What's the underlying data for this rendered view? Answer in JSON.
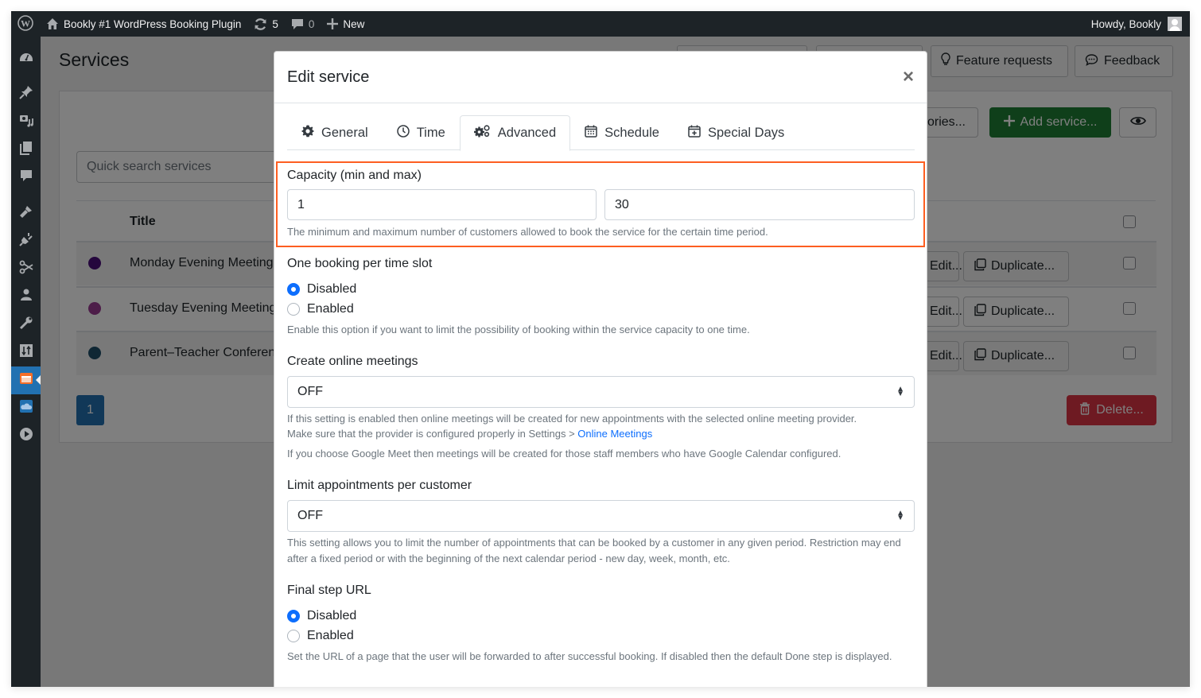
{
  "adminbar": {
    "site_name": "Bookly #1 WordPress Booking Plugin",
    "updates_count": "5",
    "comments_count": "0",
    "new_label": "New",
    "greeting": "Howdy, Bookly"
  },
  "sidebar": {
    "items": [
      {
        "icon": "dashboard-icon"
      },
      {
        "icon": "pin-icon"
      },
      {
        "icon": "media-icon"
      },
      {
        "icon": "pages-icon"
      },
      {
        "icon": "comments-icon"
      },
      {
        "icon": "appearance-icon"
      },
      {
        "icon": "plugins-icon"
      },
      {
        "icon": "scissors-icon"
      },
      {
        "icon": "users-icon"
      },
      {
        "icon": "tools-icon"
      },
      {
        "icon": "settings-icon"
      },
      {
        "icon": "bookly-calendar-icon",
        "active": true
      },
      {
        "icon": "cloud-icon"
      },
      {
        "icon": "play-icon"
      }
    ]
  },
  "page": {
    "title": "Services",
    "feature_requests_label": "Feature requests",
    "feedback_label": "Feedback",
    "categories_label": "gories...",
    "add_service_label": "Add service...",
    "search_placeholder": "Quick search services",
    "column_title": "Title",
    "rows": [
      {
        "title": "Monday Evening Meeting",
        "color": "#4b0f7a",
        "edit_label": "Edit...",
        "duplicate_label": "Duplicate..."
      },
      {
        "title": "Tuesday Evening Meeting",
        "color": "#9b3a93",
        "edit_label": "Edit...",
        "duplicate_label": "Duplicate..."
      },
      {
        "title": "Parent–Teacher Conference",
        "color": "#1e4f69",
        "edit_label": "Edit...",
        "duplicate_label": "Duplicate..."
      }
    ],
    "current_page": "1",
    "delete_label": "Delete..."
  },
  "modal": {
    "title": "Edit service",
    "close_icon": "×",
    "tabs": [
      {
        "label": "General",
        "icon": "gear-icon"
      },
      {
        "label": "Time",
        "icon": "clock-icon"
      },
      {
        "label": "Advanced",
        "icon": "gears-icon",
        "active": true
      },
      {
        "label": "Schedule",
        "icon": "calendar-icon"
      },
      {
        "label": "Special Days",
        "icon": "calendar-plus-icon"
      }
    ],
    "capacity": {
      "label": "Capacity (min and max)",
      "min": "1",
      "max": "30",
      "help": "The minimum and maximum number of customers allowed to book the service for the certain time period."
    },
    "one_booking": {
      "label": "One booking per time slot",
      "options": [
        "Disabled",
        "Enabled"
      ],
      "selected": "Disabled",
      "help": "Enable this option if you want to limit the possibility of booking within the service capacity to one time."
    },
    "online_meetings": {
      "label": "Create online meetings",
      "value": "OFF",
      "help_1": "If this setting is enabled then online meetings will be created for new appointments with the selected online meeting provider.",
      "help_2_prefix": "Make sure that the provider is configured properly in Settings > ",
      "help_2_link": "Online Meetings",
      "help_3": "If you choose Google Meet then meetings will be created for those staff members who have Google Calendar configured."
    },
    "limit_appointments": {
      "label": "Limit appointments per customer",
      "value": "OFF",
      "help": "This setting allows you to limit the number of appointments that can be booked by a customer in any given period. Restriction may end after a fixed period or with the beginning of the next calendar period - new day, week, month, etc."
    },
    "final_step_url": {
      "label": "Final step URL",
      "options": [
        "Disabled",
        "Enabled"
      ],
      "selected": "Disabled",
      "help": "Set the URL of a page that the user will be forwarded to after successful booking. If disabled then the default Done step is displayed."
    }
  },
  "colors": {
    "highlight": "#fd5e21",
    "primary": "#0d6efd",
    "success": "#1e7e34",
    "danger": "#dc3545",
    "wp_blue": "#2271b1"
  }
}
